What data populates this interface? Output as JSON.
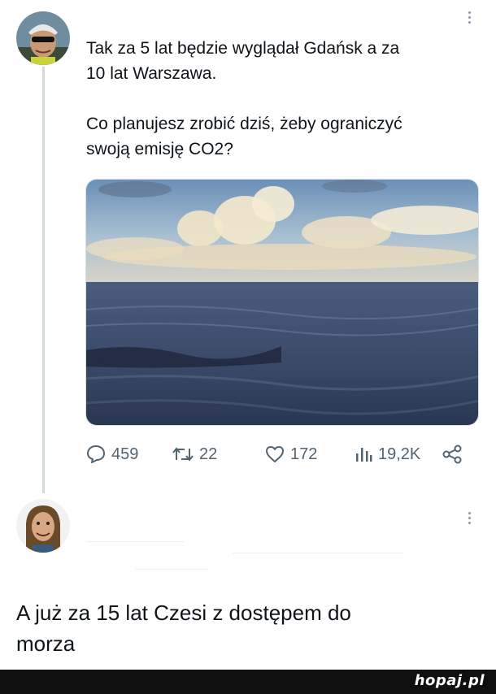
{
  "tweet": {
    "avatar": "user-avatar-cyclist",
    "text_line1": "Tak za 5 lat będzie wyglądał Gdańsk a za\n10 lat Warszawa.",
    "text_line2": "Co planujesz zrobić dziś, żeby ograniczyć\nswoją emisję CO2?",
    "media": "sea-photo",
    "actions": {
      "replies": "459",
      "retweets": "22",
      "likes": "172",
      "views": "19,2K"
    },
    "icons": {
      "reply": "reply-icon",
      "retweet": "retweet-icon",
      "like": "heart-icon",
      "views": "views-icon",
      "share": "share-icon",
      "more": "more-icon"
    }
  },
  "reply": {
    "avatar": "user-avatar-longhair",
    "text": "A już za 15 lat Czesi z dostępem do\nmorza"
  },
  "footer": {
    "brand": "hopaj.pl"
  },
  "colors": {
    "text": "#0f1419",
    "muted": "#536471",
    "thread_line": "#cfd9de",
    "footer_bg": "#0f0f0f"
  }
}
